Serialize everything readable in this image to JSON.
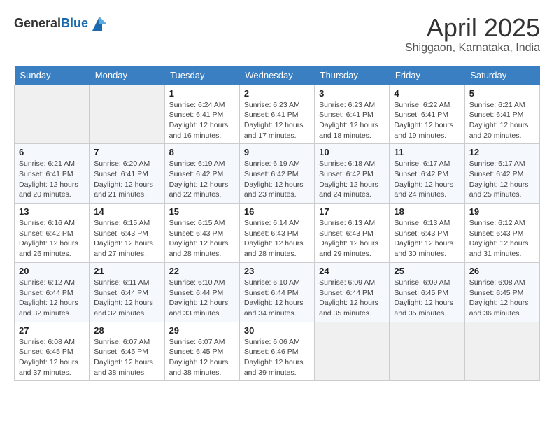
{
  "header": {
    "logo_general": "General",
    "logo_blue": "Blue",
    "month_title": "April 2025",
    "location": "Shiggaon, Karnataka, India"
  },
  "calendar": {
    "days_of_week": [
      "Sunday",
      "Monday",
      "Tuesday",
      "Wednesday",
      "Thursday",
      "Friday",
      "Saturday"
    ],
    "weeks": [
      [
        {
          "day": "",
          "text": ""
        },
        {
          "day": "",
          "text": ""
        },
        {
          "day": "1",
          "text": "Sunrise: 6:24 AM\nSunset: 6:41 PM\nDaylight: 12 hours and 16 minutes."
        },
        {
          "day": "2",
          "text": "Sunrise: 6:23 AM\nSunset: 6:41 PM\nDaylight: 12 hours and 17 minutes."
        },
        {
          "day": "3",
          "text": "Sunrise: 6:23 AM\nSunset: 6:41 PM\nDaylight: 12 hours and 18 minutes."
        },
        {
          "day": "4",
          "text": "Sunrise: 6:22 AM\nSunset: 6:41 PM\nDaylight: 12 hours and 19 minutes."
        },
        {
          "day": "5",
          "text": "Sunrise: 6:21 AM\nSunset: 6:41 PM\nDaylight: 12 hours and 20 minutes."
        }
      ],
      [
        {
          "day": "6",
          "text": "Sunrise: 6:21 AM\nSunset: 6:41 PM\nDaylight: 12 hours and 20 minutes."
        },
        {
          "day": "7",
          "text": "Sunrise: 6:20 AM\nSunset: 6:41 PM\nDaylight: 12 hours and 21 minutes."
        },
        {
          "day": "8",
          "text": "Sunrise: 6:19 AM\nSunset: 6:42 PM\nDaylight: 12 hours and 22 minutes."
        },
        {
          "day": "9",
          "text": "Sunrise: 6:19 AM\nSunset: 6:42 PM\nDaylight: 12 hours and 23 minutes."
        },
        {
          "day": "10",
          "text": "Sunrise: 6:18 AM\nSunset: 6:42 PM\nDaylight: 12 hours and 24 minutes."
        },
        {
          "day": "11",
          "text": "Sunrise: 6:17 AM\nSunset: 6:42 PM\nDaylight: 12 hours and 24 minutes."
        },
        {
          "day": "12",
          "text": "Sunrise: 6:17 AM\nSunset: 6:42 PM\nDaylight: 12 hours and 25 minutes."
        }
      ],
      [
        {
          "day": "13",
          "text": "Sunrise: 6:16 AM\nSunset: 6:42 PM\nDaylight: 12 hours and 26 minutes."
        },
        {
          "day": "14",
          "text": "Sunrise: 6:15 AM\nSunset: 6:43 PM\nDaylight: 12 hours and 27 minutes."
        },
        {
          "day": "15",
          "text": "Sunrise: 6:15 AM\nSunset: 6:43 PM\nDaylight: 12 hours and 28 minutes."
        },
        {
          "day": "16",
          "text": "Sunrise: 6:14 AM\nSunset: 6:43 PM\nDaylight: 12 hours and 28 minutes."
        },
        {
          "day": "17",
          "text": "Sunrise: 6:13 AM\nSunset: 6:43 PM\nDaylight: 12 hours and 29 minutes."
        },
        {
          "day": "18",
          "text": "Sunrise: 6:13 AM\nSunset: 6:43 PM\nDaylight: 12 hours and 30 minutes."
        },
        {
          "day": "19",
          "text": "Sunrise: 6:12 AM\nSunset: 6:43 PM\nDaylight: 12 hours and 31 minutes."
        }
      ],
      [
        {
          "day": "20",
          "text": "Sunrise: 6:12 AM\nSunset: 6:44 PM\nDaylight: 12 hours and 32 minutes."
        },
        {
          "day": "21",
          "text": "Sunrise: 6:11 AM\nSunset: 6:44 PM\nDaylight: 12 hours and 32 minutes."
        },
        {
          "day": "22",
          "text": "Sunrise: 6:10 AM\nSunset: 6:44 PM\nDaylight: 12 hours and 33 minutes."
        },
        {
          "day": "23",
          "text": "Sunrise: 6:10 AM\nSunset: 6:44 PM\nDaylight: 12 hours and 34 minutes."
        },
        {
          "day": "24",
          "text": "Sunrise: 6:09 AM\nSunset: 6:44 PM\nDaylight: 12 hours and 35 minutes."
        },
        {
          "day": "25",
          "text": "Sunrise: 6:09 AM\nSunset: 6:45 PM\nDaylight: 12 hours and 35 minutes."
        },
        {
          "day": "26",
          "text": "Sunrise: 6:08 AM\nSunset: 6:45 PM\nDaylight: 12 hours and 36 minutes."
        }
      ],
      [
        {
          "day": "27",
          "text": "Sunrise: 6:08 AM\nSunset: 6:45 PM\nDaylight: 12 hours and 37 minutes."
        },
        {
          "day": "28",
          "text": "Sunrise: 6:07 AM\nSunset: 6:45 PM\nDaylight: 12 hours and 38 minutes."
        },
        {
          "day": "29",
          "text": "Sunrise: 6:07 AM\nSunset: 6:45 PM\nDaylight: 12 hours and 38 minutes."
        },
        {
          "day": "30",
          "text": "Sunrise: 6:06 AM\nSunset: 6:46 PM\nDaylight: 12 hours and 39 minutes."
        },
        {
          "day": "",
          "text": ""
        },
        {
          "day": "",
          "text": ""
        },
        {
          "day": "",
          "text": ""
        }
      ]
    ]
  }
}
